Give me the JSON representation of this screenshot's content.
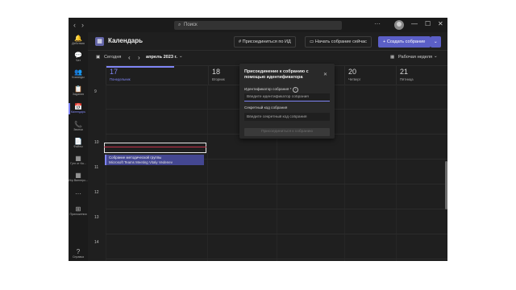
{
  "search": {
    "placeholder": "Поиск"
  },
  "window_controls": {
    "more": "···",
    "minimize": "—",
    "maximize": "☐",
    "close": "✕"
  },
  "rail": {
    "items": [
      {
        "label": "Действия",
        "icon": "🔔"
      },
      {
        "label": "Чат",
        "icon": "💬"
      },
      {
        "label": "Команды",
        "icon": "👥"
      },
      {
        "label": "Задания",
        "icon": "📋"
      },
      {
        "label": "Календарь",
        "icon": "📅",
        "active": true
      },
      {
        "label": "Звонки",
        "icon": "📞"
      },
      {
        "label": "Файлы",
        "icon": "📄"
      },
      {
        "label": "Гугл от Ка...",
        "icon": "▦"
      },
      {
        "label": "Игр Виннерс...",
        "icon": "▦"
      },
      {
        "label": "...",
        "icon": "···"
      },
      {
        "label": "Приложения",
        "icon": "⊞"
      },
      {
        "label": "Справка",
        "icon": "?"
      }
    ]
  },
  "header": {
    "title": "Календарь",
    "join_by_id": "Присоединиться по ИД",
    "meet_now": "Начать собрание сейчас",
    "new_meeting": "Создать собрание"
  },
  "toolbar": {
    "today": "Сегодня",
    "month": "апрель 2023 г.",
    "view": "Рабочая неделя"
  },
  "days": [
    {
      "num": "17",
      "weekday": "Понедельник",
      "today": true
    },
    {
      "num": "18",
      "weekday": "Вторник"
    },
    {
      "num": "19",
      "weekday": "Среда"
    },
    {
      "num": "20",
      "weekday": "Четверг"
    },
    {
      "num": "21",
      "weekday": "Пятница"
    }
  ],
  "hours": [
    "9",
    "10",
    "11",
    "12",
    "13",
    "14"
  ],
  "event": {
    "title": "Собрание методической группы",
    "subtitle": "Microsoft Teams Meeting  Vitaly Vedenev"
  },
  "dialog": {
    "title": "Присоединение к собранию с помощью идентификатора",
    "id_label": "Идентификатор собрания *",
    "id_placeholder": "Введите идентификатор собрания",
    "code_label": "Секретный код собрания",
    "code_placeholder": "Введите секретный код собрания",
    "join_button": "Присоединиться к собранию"
  }
}
